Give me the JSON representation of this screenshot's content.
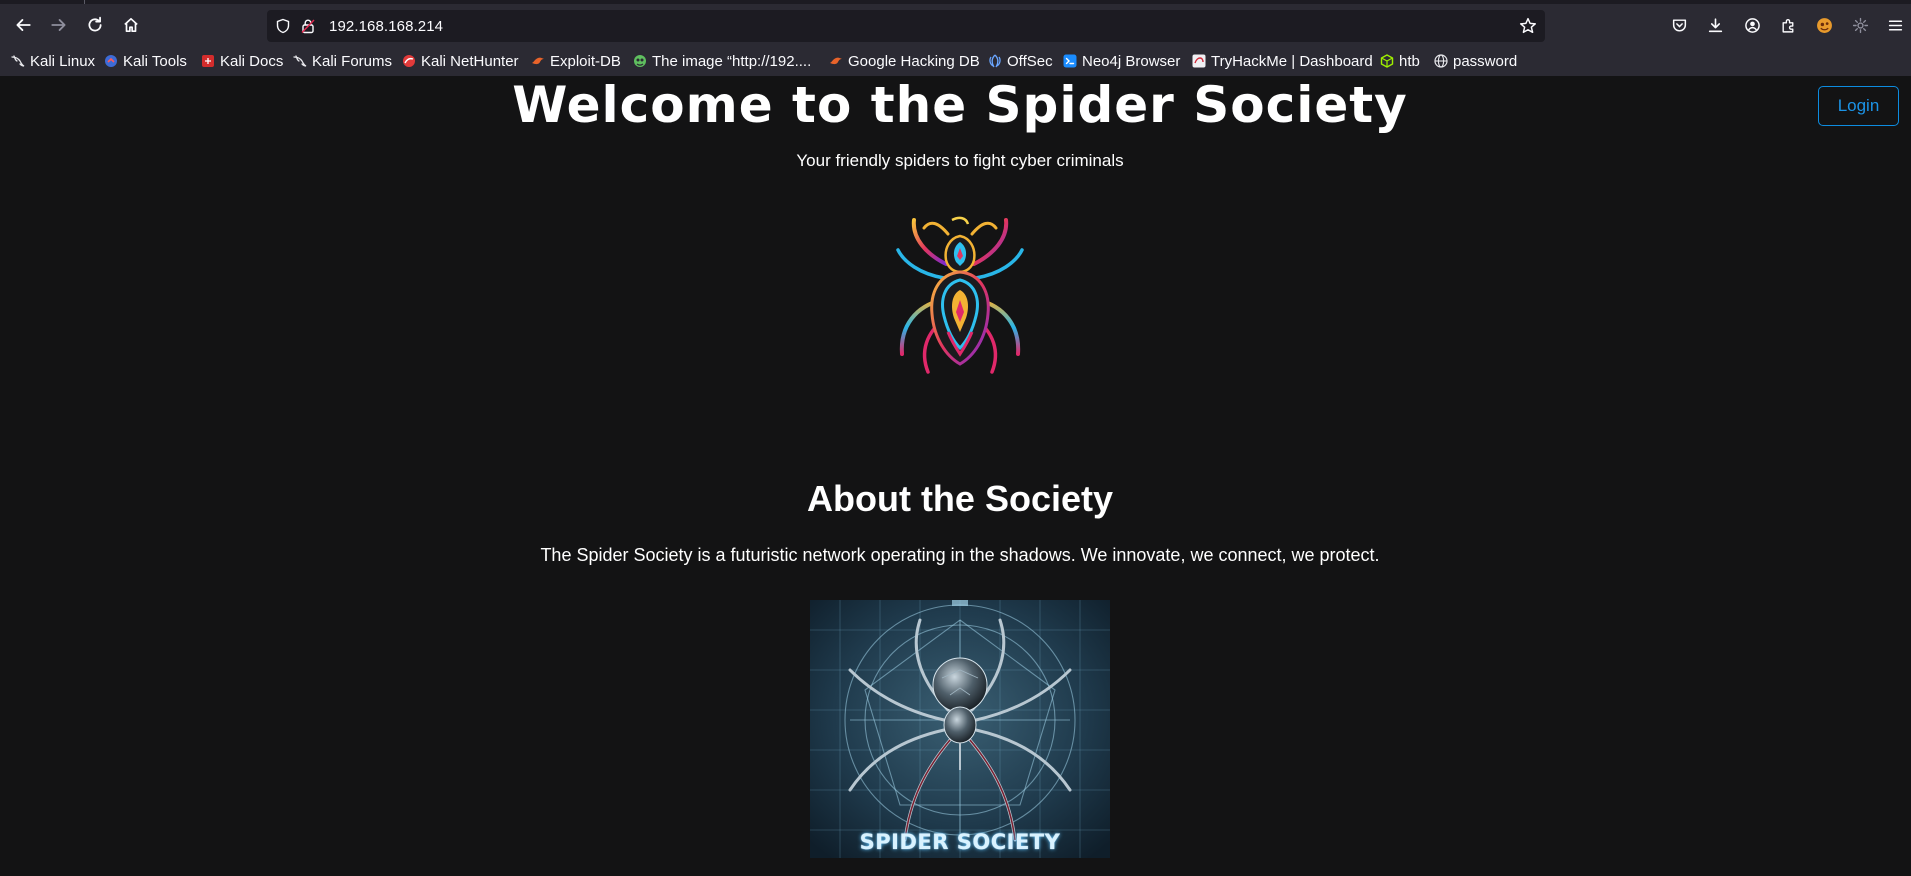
{
  "browser": {
    "url": "192.168.168.214",
    "nav": {
      "back_icon": "arrow-left-icon",
      "forward_icon": "arrow-right-icon",
      "reload_icon": "reload-icon",
      "home_icon": "home-icon"
    },
    "toolbar_icons": [
      "pocket-icon",
      "download-icon",
      "account-icon",
      "extensions-icon",
      "profile-icon",
      "settings-icon",
      "menu-icon"
    ],
    "bookmarks": [
      {
        "label": "Kali Linux",
        "icon": "kali-dragon-icon"
      },
      {
        "label": "Kali Tools",
        "icon": "kali-tools-icon"
      },
      {
        "label": "Kali Docs",
        "icon": "kali-docs-icon"
      },
      {
        "label": "Kali Forums",
        "icon": "kali-dragon-icon"
      },
      {
        "label": "Kali NetHunter",
        "icon": "nethunter-icon"
      },
      {
        "label": "Exploit-DB",
        "icon": "exploit-db-icon"
      },
      {
        "label": "The image “http://192....",
        "icon": "image-icon"
      },
      {
        "label": "Google Hacking DB",
        "icon": "exploit-db-icon"
      },
      {
        "label": "OffSec",
        "icon": "offsec-icon"
      },
      {
        "label": "Neo4j Browser",
        "icon": "neo4j-icon"
      },
      {
        "label": "TryHackMe | Dashboard",
        "icon": "tryhackme-icon"
      },
      {
        "label": "htb",
        "icon": "htb-cube-icon"
      },
      {
        "label": "password",
        "icon": "globe-icon"
      }
    ]
  },
  "page": {
    "title": "Welcome to the Spider Society",
    "subtitle": "Your friendly spiders to fight cyber criminals",
    "login_label": "Login",
    "about_heading": "About the Society",
    "about_text": "The Spider Society is a futuristic network operating in the shadows. We innovate, we connect, we protect.",
    "poster_caption": "SPIDER SOCIETY"
  },
  "colors": {
    "background": "#131314",
    "chrome": "#2b2a33",
    "accent": "#0d8ce0",
    "text": "#ffffff"
  }
}
